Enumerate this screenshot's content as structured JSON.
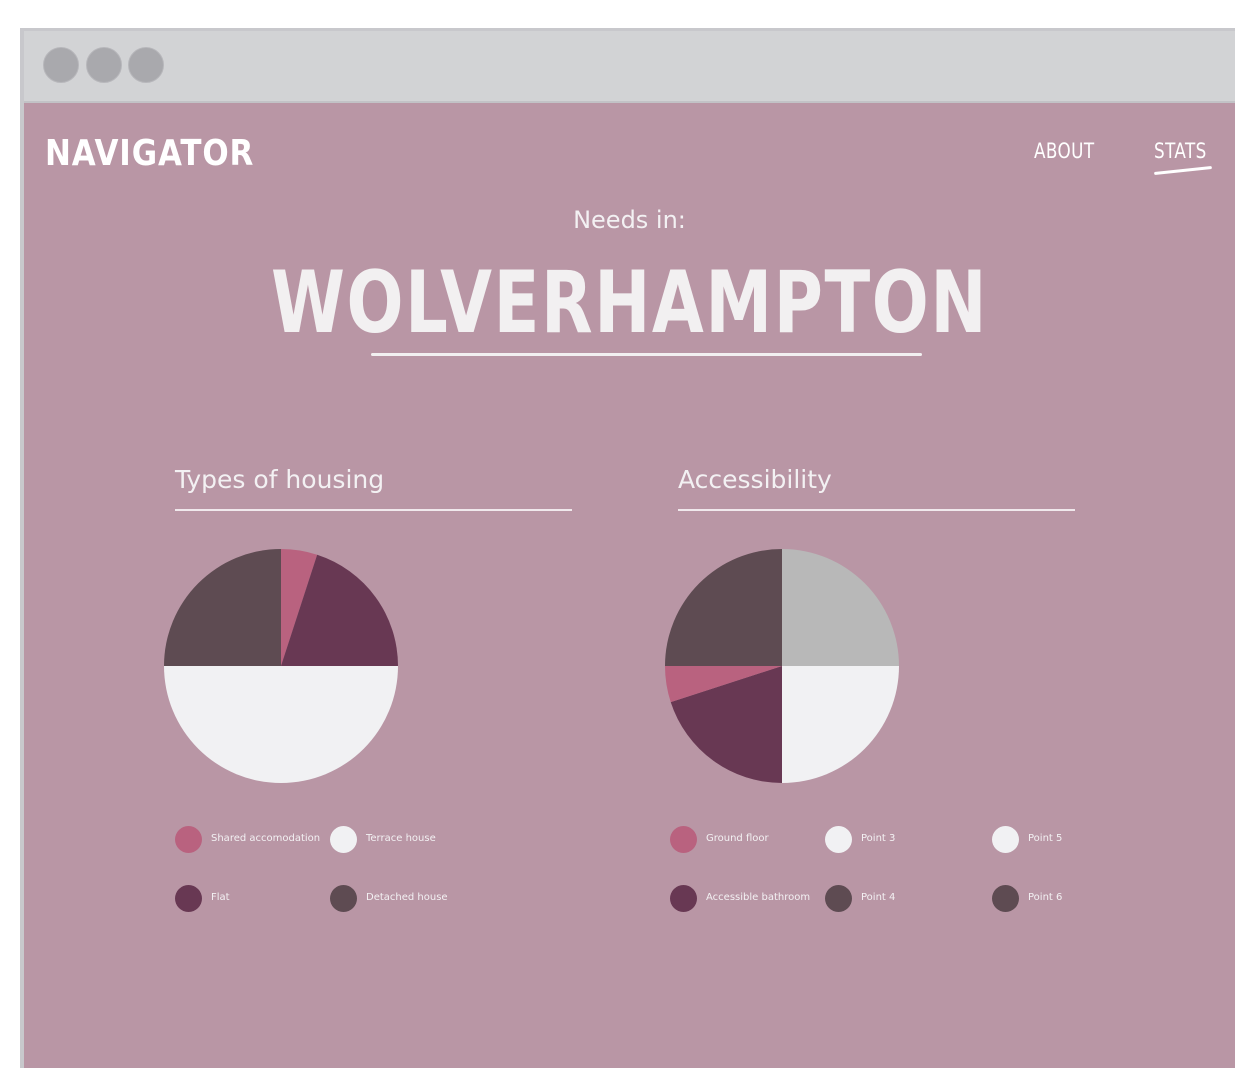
{
  "colors": {
    "background": "#b996a5",
    "pink": "#b9627f",
    "plum": "#683853",
    "dark": "#5e4b52",
    "white": "#f1f1f3",
    "grey": "#b8b8b8"
  },
  "window": {
    "controls": [
      "close-dot",
      "minimize-dot",
      "maximize-dot"
    ]
  },
  "header": {
    "logo": "NAVIGATOR",
    "nav": [
      {
        "label": "ABOUT",
        "active": false
      },
      {
        "label": "STATS",
        "active": true
      }
    ]
  },
  "hero": {
    "subtitle": "Needs in:",
    "city": "WOLVERHAMPTON"
  },
  "sections": {
    "housing": {
      "title": "Types of housing"
    },
    "accessibility": {
      "title": "Accessibility"
    }
  },
  "chart_data": [
    {
      "type": "pie",
      "title": "Types of housing",
      "slices": [
        {
          "label": "Shared accomodation",
          "value": 5,
          "color": "#b9627f"
        },
        {
          "label": "Flat",
          "value": 20,
          "color": "#683853"
        },
        {
          "label": "Terrace house",
          "value": 50,
          "color": "#f1f1f3"
        },
        {
          "label": "Detached house",
          "value": 25,
          "color": "#5e4b52"
        }
      ],
      "legend": [
        {
          "label": "Shared accomodation",
          "color": "#b9627f"
        },
        {
          "label": "Terrace house",
          "color": "#f1f1f3"
        },
        {
          "label": "Flat",
          "color": "#683853"
        },
        {
          "label": "Detached house",
          "color": "#5e4b52"
        }
      ]
    },
    {
      "type": "pie",
      "title": "Accessibility",
      "slices": [
        {
          "label": "Point 3",
          "value": 25,
          "color": "#b8b8b8"
        },
        {
          "label": "Point 5",
          "value": 25,
          "color": "#f1f1f3"
        },
        {
          "label": "Accessible bathroom",
          "value": 20,
          "color": "#683853"
        },
        {
          "label": "Ground floor",
          "value": 5,
          "color": "#b9627f"
        },
        {
          "label": "Point 4",
          "value": 25,
          "color": "#5e4b52"
        }
      ],
      "legend": [
        {
          "label": "Ground floor",
          "color": "#b9627f"
        },
        {
          "label": "Point 3",
          "color": "#f1f1f3"
        },
        {
          "label": "Point 5",
          "color": "#f1f1f3"
        },
        {
          "label": "Accessible bathroom",
          "color": "#683853"
        },
        {
          "label": "Point 4",
          "color": "#5e4b52"
        },
        {
          "label": "Point 6",
          "color": "#5e4b52"
        }
      ]
    }
  ]
}
